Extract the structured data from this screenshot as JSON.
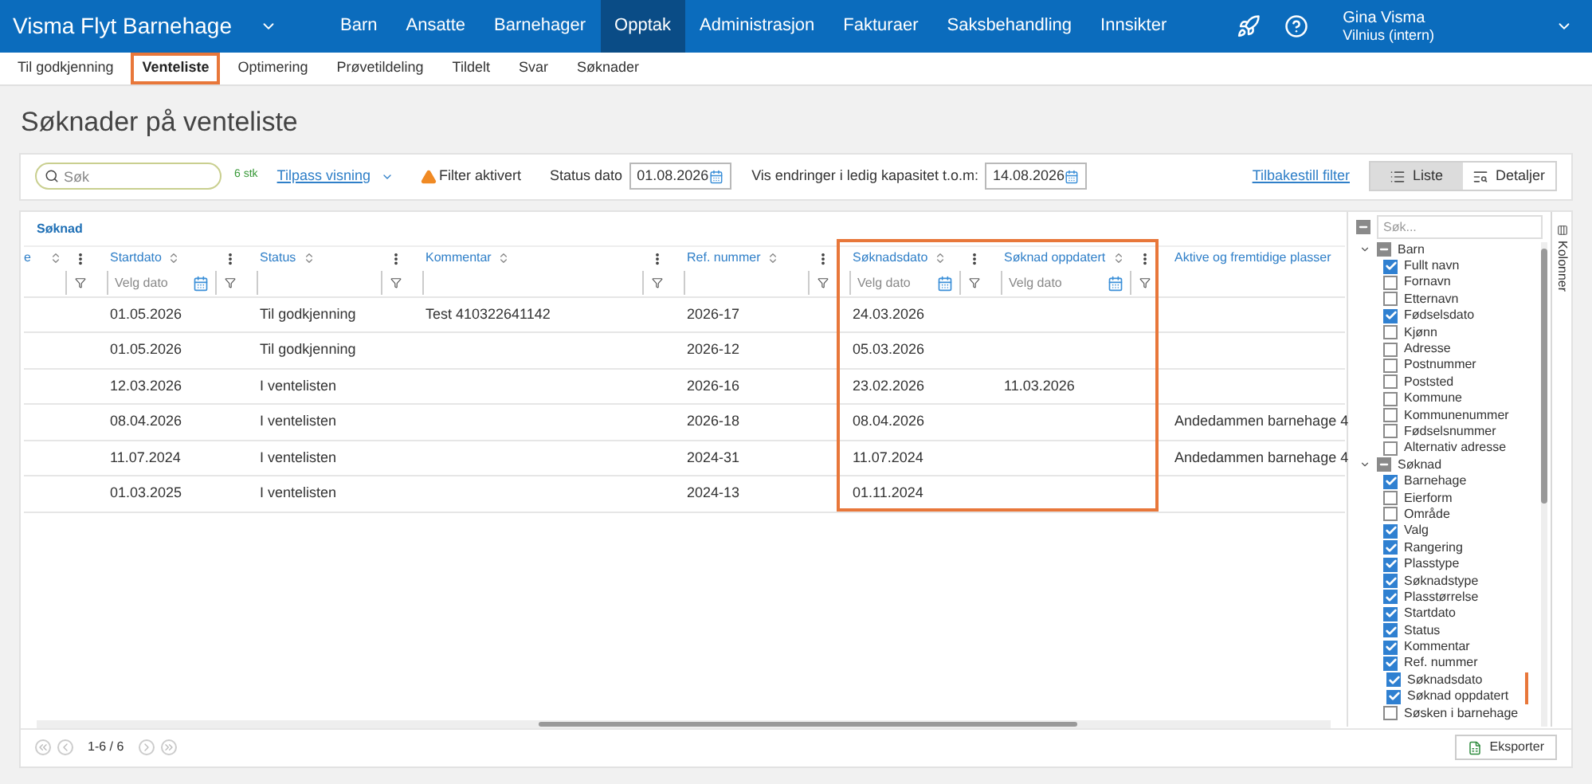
{
  "topbar": {
    "app_title": "Visma Flyt Barnehage",
    "menu": [
      {
        "label": "Barn",
        "selected": false
      },
      {
        "label": "Ansatte",
        "selected": false
      },
      {
        "label": "Barnehager",
        "selected": false
      },
      {
        "label": "Opptak",
        "selected": true
      },
      {
        "label": "Administrasjon",
        "selected": false
      },
      {
        "label": "Fakturaer",
        "selected": false
      },
      {
        "label": "Saksbehandling",
        "selected": false
      },
      {
        "label": "Innsikter",
        "selected": false
      }
    ],
    "user_name": "Gina Visma",
    "user_org": "Vilnius (intern)"
  },
  "subnav": [
    {
      "label": "Til godkjenning",
      "selected": false,
      "highlighted": false
    },
    {
      "label": "Venteliste",
      "selected": true,
      "highlighted": true
    },
    {
      "label": "Optimering",
      "selected": false,
      "highlighted": false
    },
    {
      "label": "Prøvetildeling",
      "selected": false,
      "highlighted": false
    },
    {
      "label": "Tildelt",
      "selected": false,
      "highlighted": false
    },
    {
      "label": "Svar",
      "selected": false,
      "highlighted": false
    },
    {
      "label": "Søknader",
      "selected": false,
      "highlighted": false
    }
  ],
  "page_title": "Søknader på venteliste",
  "toolbar": {
    "search_placeholder": "Søk",
    "count": "6 stk",
    "customize_link": "Tilpass visning",
    "filter_warning": "Filter aktivert",
    "status_date_label": "Status dato",
    "status_date": "01.08.2026",
    "changes_label": "Vis endringer i ledig kapasitet t.o.m:",
    "changes_date": "14.08.2026",
    "reset_link": "Tilbakestill filter",
    "views": [
      {
        "label": "Liste",
        "kind": "list",
        "selected": true
      },
      {
        "label": "Detaljer",
        "kind": "details",
        "selected": false
      }
    ]
  },
  "grid": {
    "group_header": "Søknad",
    "columns": [
      {
        "label": "e",
        "kind": "text",
        "highlighted": false
      },
      {
        "label": "Startdato",
        "kind": "date",
        "placeholder": "Velg dato",
        "highlighted": false
      },
      {
        "label": "Status",
        "kind": "text",
        "highlighted": false
      },
      {
        "label": "Kommentar",
        "kind": "text",
        "highlighted": false
      },
      {
        "label": "Ref. nummer",
        "kind": "text",
        "highlighted": false
      },
      {
        "label": "Søknadsdato",
        "kind": "date",
        "placeholder": "Velg dato",
        "highlighted": true
      },
      {
        "label": "Søknad oppdatert",
        "kind": "date",
        "placeholder": "Velg dato",
        "highlighted": true
      },
      {
        "label": "Aktive og fremtidige plasser",
        "kind": "plain",
        "highlighted": false
      }
    ],
    "rows": [
      [
        null,
        "01.05.2026",
        "Til godkjenning",
        "Test 410322641142",
        "2026-17",
        "24.03.2026",
        null,
        null
      ],
      [
        null,
        "01.05.2026",
        "Til godkjenning",
        null,
        "2026-12",
        "05.03.2026",
        null,
        null
      ],
      [
        null,
        "12.03.2026",
        "I ventelisten",
        null,
        "2026-16",
        "23.02.2026",
        "11.03.2026",
        null
      ],
      [
        null,
        "08.04.2026",
        "I ventelisten",
        null,
        "2026-18",
        "08.04.2026",
        null,
        "Andedammen barnehage 4"
      ],
      [
        null,
        "11.07.2024",
        "I ventelisten",
        null,
        "2024-31",
        "11.07.2024",
        null,
        "Andedammen barnehage 4"
      ],
      [
        null,
        "01.03.2025",
        "I ventelisten",
        null,
        "2024-13",
        "01.11.2024",
        null,
        null
      ]
    ],
    "pagination": "1-6 / 6",
    "export_button": "Eksporter"
  },
  "columns_panel": {
    "select_all_indeterminate": true,
    "search_placeholder": "Søk...",
    "side_tab": "Kolonner",
    "groups": [
      {
        "label": "Barn",
        "expanded": true,
        "indeterminate": true,
        "children": [
          {
            "label": "Fullt navn",
            "checked": true,
            "highlighted": false
          },
          {
            "label": "Fornavn",
            "checked": false,
            "highlighted": false
          },
          {
            "label": "Etternavn",
            "checked": false,
            "highlighted": false
          },
          {
            "label": "Fødselsdato",
            "checked": true,
            "highlighted": false
          },
          {
            "label": "Kjønn",
            "checked": false,
            "highlighted": false
          },
          {
            "label": "Adresse",
            "checked": false,
            "highlighted": false
          },
          {
            "label": "Postnummer",
            "checked": false,
            "highlighted": false
          },
          {
            "label": "Poststed",
            "checked": false,
            "highlighted": false
          },
          {
            "label": "Kommune",
            "checked": false,
            "highlighted": false
          },
          {
            "label": "Kommunenummer",
            "checked": false,
            "highlighted": false
          },
          {
            "label": "Fødselsnummer",
            "checked": false,
            "highlighted": false
          },
          {
            "label": "Alternativ adresse",
            "checked": false,
            "highlighted": false
          }
        ]
      },
      {
        "label": "Søknad",
        "expanded": true,
        "indeterminate": true,
        "children": [
          {
            "label": "Barnehage",
            "checked": true,
            "highlighted": false
          },
          {
            "label": "Eierform",
            "checked": false,
            "highlighted": false
          },
          {
            "label": "Område",
            "checked": false,
            "highlighted": false
          },
          {
            "label": "Valg",
            "checked": true,
            "highlighted": false
          },
          {
            "label": "Rangering",
            "checked": true,
            "highlighted": false
          },
          {
            "label": "Plasstype",
            "checked": true,
            "highlighted": false
          },
          {
            "label": "Søknadstype",
            "checked": true,
            "highlighted": false
          },
          {
            "label": "Plasstørrelse",
            "checked": true,
            "highlighted": false
          },
          {
            "label": "Startdato",
            "checked": true,
            "highlighted": false
          },
          {
            "label": "Status",
            "checked": true,
            "highlighted": false
          },
          {
            "label": "Kommentar",
            "checked": true,
            "highlighted": false
          },
          {
            "label": "Ref. nummer",
            "checked": true,
            "highlighted": false
          },
          {
            "label": "Søknadsdato",
            "checked": true,
            "highlighted": true
          },
          {
            "label": "Søknad oppdatert",
            "checked": true,
            "highlighted": true
          },
          {
            "label": "Søsken i barnehage",
            "checked": false,
            "highlighted": false
          }
        ]
      }
    ]
  }
}
